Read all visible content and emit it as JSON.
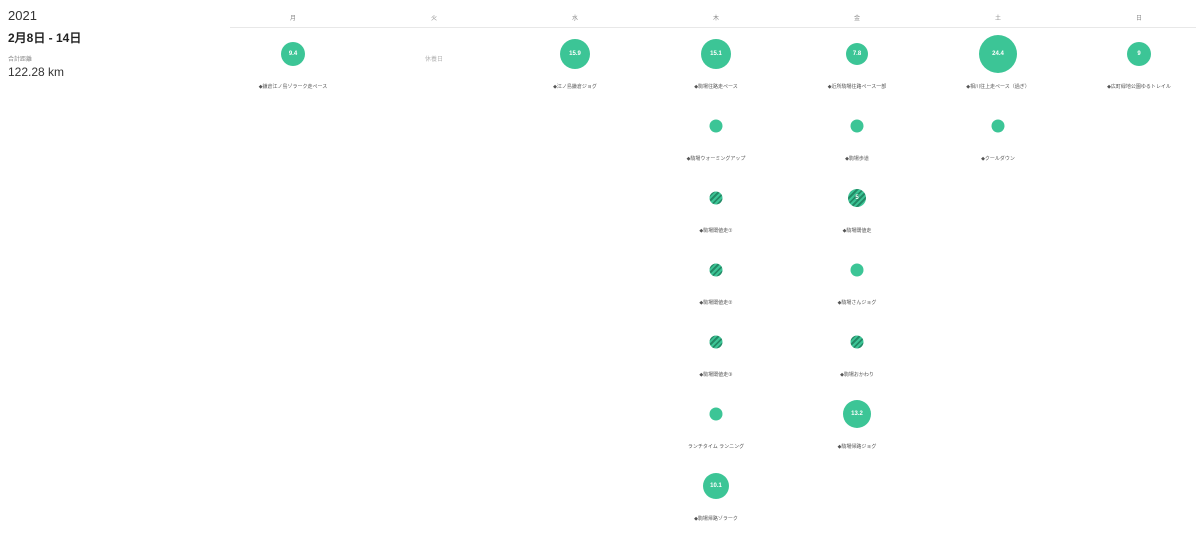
{
  "year": "2021",
  "week_range": "2月8日 - 14日",
  "total_label": "合計距離",
  "total_value": "122.28 km",
  "colors": {
    "accent": "#3cc596",
    "hatch_dark": "#238a66"
  },
  "days": [
    {
      "name": "月",
      "rest": "",
      "activities": [
        {
          "value": "9.4",
          "label": "◆鎌倉江ノ島ゾラーク走ペース",
          "style": "solid",
          "size": 24
        }
      ]
    },
    {
      "name": "火",
      "rest": "休養日",
      "activities": []
    },
    {
      "name": "水",
      "rest": "",
      "activities": [
        {
          "value": "15.9",
          "label": "◆江ノ島鎌倉ジョグ",
          "style": "solid",
          "size": 30
        }
      ]
    },
    {
      "name": "木",
      "rest": "",
      "activities": [
        {
          "value": "15.1",
          "label": "◆駒場往路走ペース",
          "style": "solid",
          "size": 30
        },
        {
          "value": "",
          "label": "◆駒場ウォーミングアップ",
          "style": "solid",
          "size": 13
        },
        {
          "value": "",
          "label": "◆駒場閾値走①",
          "style": "hatched",
          "size": 13
        },
        {
          "value": "",
          "label": "◆駒場閾値走②",
          "style": "hatched",
          "size": 13
        },
        {
          "value": "",
          "label": "◆駒場閾値走③",
          "style": "hatched",
          "size": 13
        },
        {
          "value": "",
          "label": "ランチタイム ランニング",
          "style": "solid",
          "size": 13
        },
        {
          "value": "10.1",
          "label": "◆駒場帰路ゾラーク",
          "style": "solid",
          "size": 26
        }
      ]
    },
    {
      "name": "金",
      "rest": "",
      "activities": [
        {
          "value": "7.8",
          "label": "◆近所駒場往路ペース一部",
          "style": "solid",
          "size": 22
        },
        {
          "value": "",
          "label": "◆駒場歩道",
          "style": "solid",
          "size": 13
        },
        {
          "value": "5",
          "label": "◆駒場閾値走",
          "style": "hatched",
          "size": 18
        },
        {
          "value": "",
          "label": "◆駒場さんジョグ",
          "style": "solid",
          "size": 13
        },
        {
          "value": "",
          "label": "◆駒場おかわり",
          "style": "hatched",
          "size": 13
        },
        {
          "value": "13.2",
          "label": "◆駒場帰路ジョグ",
          "style": "solid",
          "size": 28
        }
      ]
    },
    {
      "name": "土",
      "rest": "",
      "activities": [
        {
          "value": "24.4",
          "label": "◆相川往上走ペース（過ぎ）",
          "style": "solid",
          "size": 38
        },
        {
          "value": "",
          "label": "◆クールダウン",
          "style": "solid",
          "size": 13
        }
      ]
    },
    {
      "name": "日",
      "rest": "",
      "activities": [
        {
          "value": "9",
          "label": "◆広町緑地公園ゆるトレイル",
          "style": "solid",
          "size": 24
        }
      ]
    }
  ]
}
